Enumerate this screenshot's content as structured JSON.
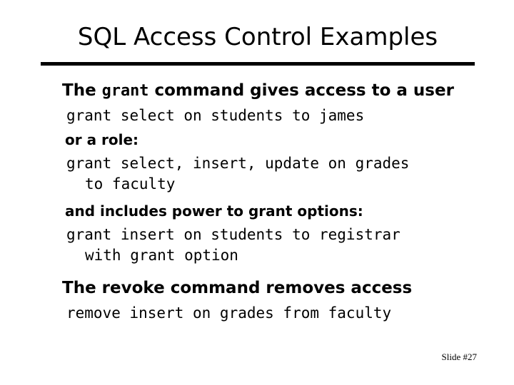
{
  "slide": {
    "title": "SQL Access Control Examples",
    "footer": "Slide #27",
    "background_color": "#ffffff",
    "text_color": "#000000",
    "rule_color": "#000000"
  },
  "body": {
    "block1": {
      "heading_part1": "The ",
      "heading_mono": "grant",
      "heading_part2": " command gives access to a user",
      "code": "grant select on students to james"
    },
    "block2": {
      "heading": "or a role:",
      "code_line1": "grant select, insert, update on grades",
      "code_line2": "to faculty"
    },
    "block3": {
      "heading": "and includes power to grant options:",
      "code_line1": "grant insert on students to registrar",
      "code_line2": "with grant option"
    },
    "block4": {
      "heading": "The revoke command removes access",
      "code": "remove insert on grades from faculty"
    }
  }
}
